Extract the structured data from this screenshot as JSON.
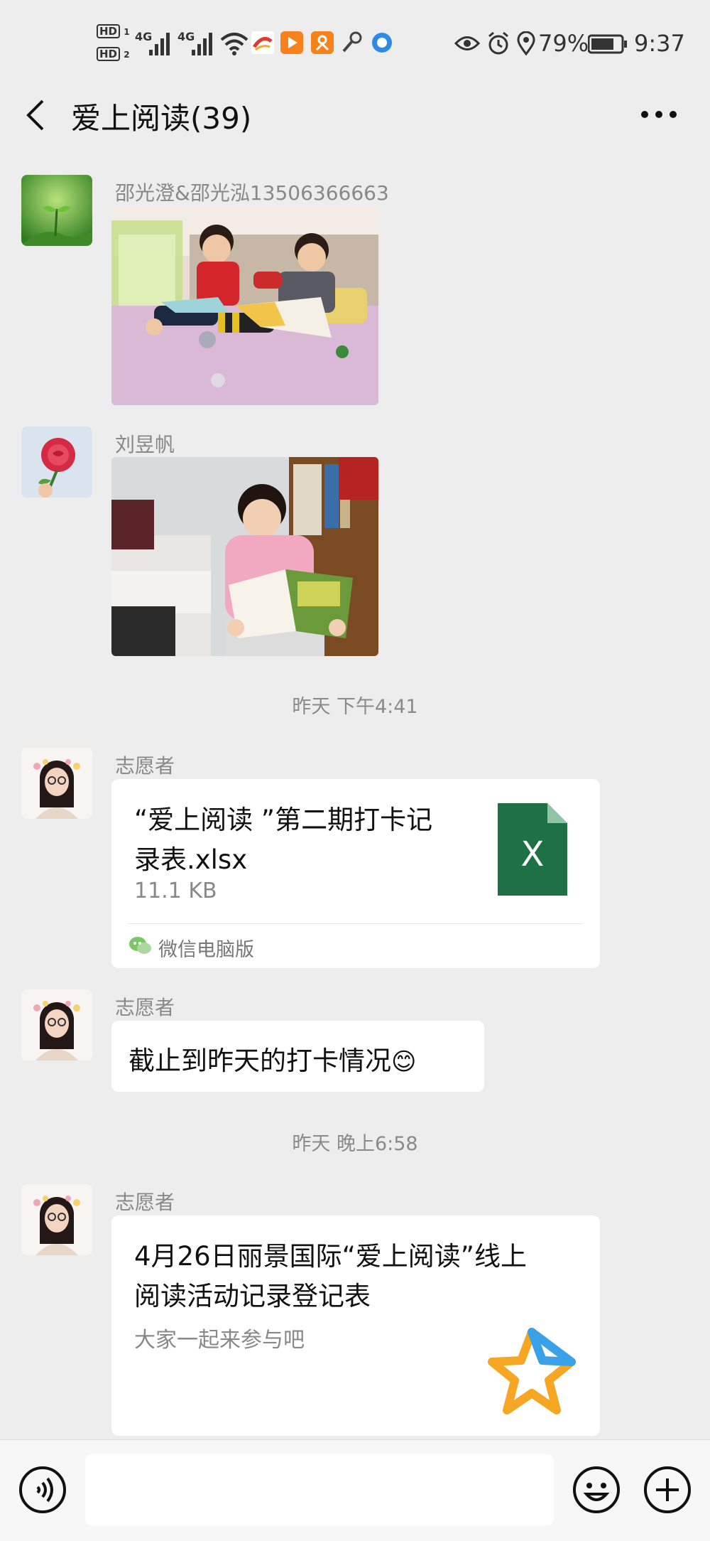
{
  "status_bar": {
    "hd1": "HD",
    "hd2": "HD",
    "sim1_sub": "1",
    "sim2_sub": "2",
    "net1": "4G",
    "net2": "4G",
    "battery": "79%",
    "time": "9:37",
    "icons": [
      "eye-icon",
      "alarm-icon",
      "location-icon",
      "battery-icon",
      "wifi-icon",
      "signal-icon",
      "key-icon"
    ]
  },
  "header": {
    "title": "爱上阅读(39)",
    "back_icon": "chevron-left-icon",
    "more_icon": "more-icon"
  },
  "messages": [
    {
      "type": "image",
      "sender": "邵光澄&邵光泓13506366663",
      "image": "two boys reading picture books on a bed"
    },
    {
      "type": "image",
      "sender": "刘昱帆",
      "image": "girl reading a book"
    },
    {
      "type": "time",
      "text": "昨天 下午4:41"
    },
    {
      "type": "file",
      "sender": "志愿者",
      "file_name": "“爱上阅读 ”第二期打卡记录表.xlsx",
      "file_name_line1": "“爱上阅读 ”第二期打卡记",
      "file_name_line2": "录表.xlsx",
      "file_size": "11.1 KB",
      "file_icon_label": "X",
      "source": "微信电脑版"
    },
    {
      "type": "text",
      "sender": "志愿者",
      "text": "截止到昨天的打卡情况",
      "emoji": "😊"
    },
    {
      "type": "time",
      "text": "昨天 晚上6:58"
    },
    {
      "type": "link",
      "sender": "志愿者",
      "title_line1": "4月26日丽景国际“爱上阅读”线上",
      "title_line2": "阅读活动记录登记表",
      "desc": "大家一起来参与吧",
      "icon": "star-icon"
    }
  ],
  "input_bar": {
    "voice_icon": "voice-icon",
    "emoji_icon": "emoji-icon",
    "plus_icon": "plus-icon",
    "input_value": ""
  },
  "colors": {
    "background": "#ededed",
    "bubble": "#ffffff",
    "excel_green": "#1e7145",
    "accent_orange": "#f5a623",
    "accent_blue": "#3aa0e8"
  }
}
